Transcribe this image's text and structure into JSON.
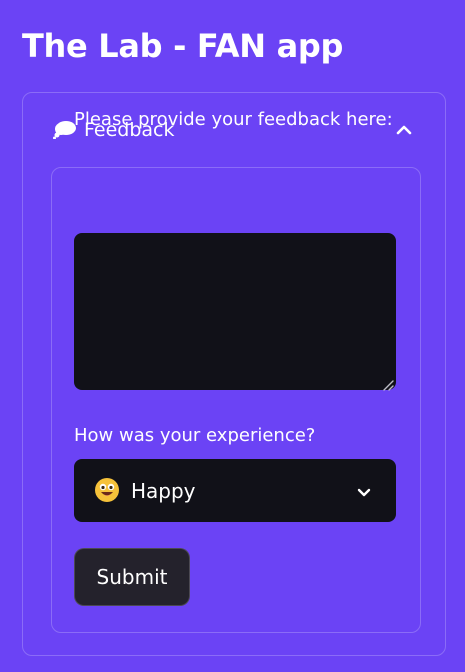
{
  "page": {
    "title": "The Lab - FAN app"
  },
  "expander": {
    "label": "Feedback",
    "icon": "speech-bubble-icon",
    "expanded": true
  },
  "form": {
    "feedback": {
      "label": "Please provide your feedback here:",
      "value": ""
    },
    "experience": {
      "label": "How was your experience?",
      "selected_value": "Happy",
      "selected_icon": "grinning-face-emoji-icon"
    },
    "submit_label": "Submit"
  },
  "colors": {
    "background": "#6b43f5",
    "input_background": "#111118",
    "button_background": "#24222c",
    "text": "#ffffff"
  }
}
